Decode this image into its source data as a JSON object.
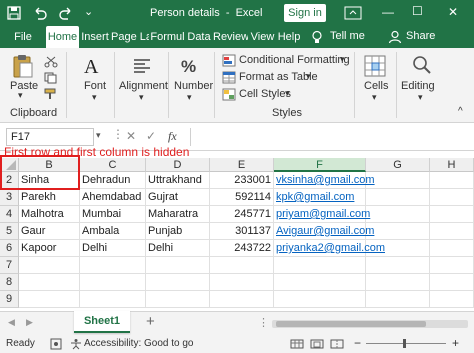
{
  "window": {
    "autosave_icon": "save-icon",
    "undo_icon": "undo-icon",
    "redo_icon": "redo-icon",
    "title": "Person details  -  Excel",
    "signin_label": "Sign in",
    "minimize": "—",
    "maximize": "☐",
    "close": "✕",
    "accent": "#217346"
  },
  "tabs": [
    "File",
    "Home",
    "Insert",
    "Page La",
    "Formul",
    "Data",
    "Review",
    "View",
    "Help"
  ],
  "tell_me": "Tell me",
  "share": "Share",
  "ribbon": {
    "paste_label": "Paste",
    "clipboard_label": "Clipboard",
    "font_label": "Font",
    "alignment_label": "Alignment",
    "number_label": "Number",
    "conditional_formatting": "Conditional Formatting",
    "format_as_table": "Format as Table",
    "cell_styles": "Cell Styles",
    "styles_label": "Styles",
    "cells_label": "Cells",
    "editing_label": "Editing",
    "dropdown_arrow": "▾",
    "collapse_arrow": "^"
  },
  "formula_bar": {
    "name_box": "F17",
    "cancel": "✕",
    "enter": "✓",
    "fx": "fx",
    "formula": ""
  },
  "annotation": "First row and first column is hidden",
  "columns": [
    "B",
    "C",
    "D",
    "E",
    "F",
    "G",
    "H"
  ],
  "rows": [
    {
      "num": "2",
      "b": "Sinha",
      "c": "Dehradun",
      "d": "Uttrakhand",
      "e": "233001",
      "f": "vksinha@gmail.com"
    },
    {
      "num": "3",
      "b": "Parekh",
      "c": "Ahemdabad",
      "d": "Gujrat",
      "e": "592114",
      "f": "kpk@gmail.com"
    },
    {
      "num": "4",
      "b": "Malhotra",
      "c": "Mumbai",
      "d": "Maharatra",
      "e": "245771",
      "f": "priyam@gmail.com"
    },
    {
      "num": "5",
      "b": "Gaur",
      "c": "Ambala",
      "d": "Punjab",
      "e": "301137",
      "f": "Avigaur@gmail.com"
    },
    {
      "num": "6",
      "b": "Kapoor",
      "c": "Delhi",
      "d": "Delhi",
      "e": "243722",
      "f": "priyanka2@gmail.com"
    },
    {
      "num": "7",
      "b": "",
      "c": "",
      "d": "",
      "e": "",
      "f": ""
    },
    {
      "num": "8",
      "b": "",
      "c": "",
      "d": "",
      "e": "",
      "f": ""
    },
    {
      "num": "9",
      "b": "",
      "c": "",
      "d": "",
      "e": "",
      "f": ""
    }
  ],
  "sheet": {
    "prev": "◀",
    "next": "▶",
    "tab": "Sheet1",
    "add": "+",
    "more": "⋮"
  },
  "status": {
    "ready": "Ready",
    "accessibility": "Accessibility: Good to go",
    "zoom_minus": "−",
    "zoom_plus": "+"
  }
}
